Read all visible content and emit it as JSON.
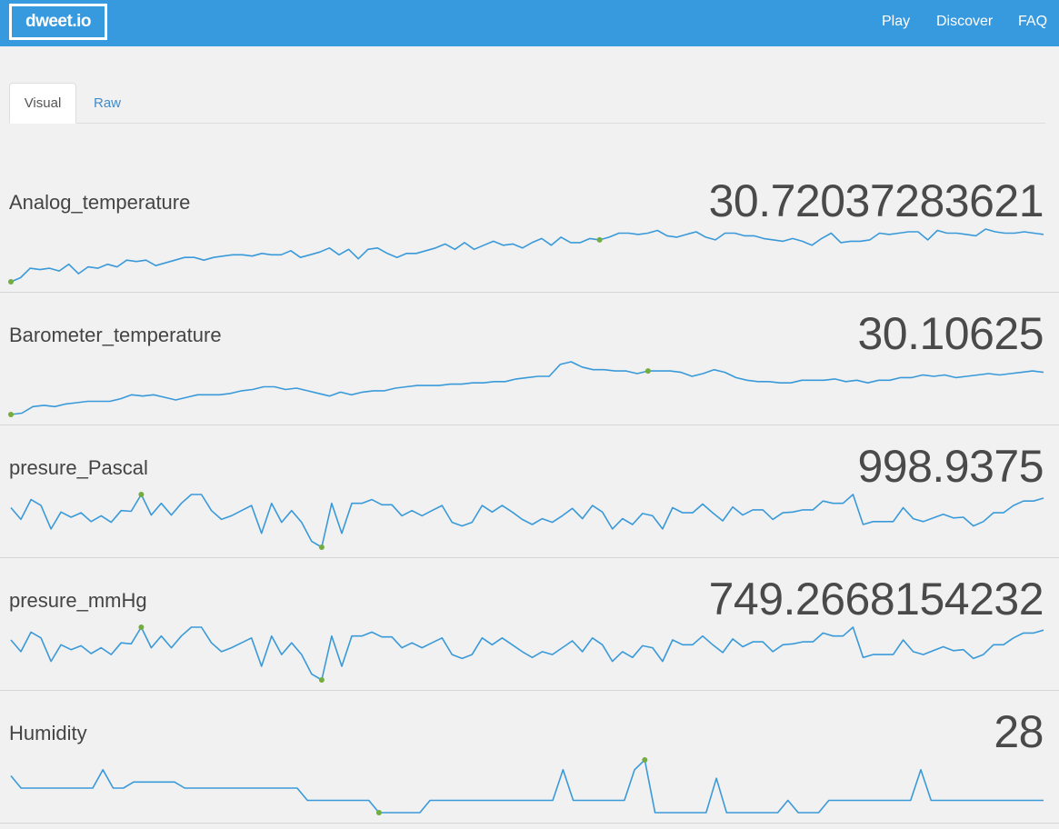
{
  "navbar": {
    "brand": "dweet.io",
    "links": [
      "Play",
      "Discover",
      "FAQ"
    ],
    "background": "#3799de"
  },
  "tabs": {
    "visual": "Visual",
    "raw": "Raw",
    "active": "Visual"
  },
  "colors": {
    "line": "#3a9ad9",
    "marker": "#72ad3d"
  },
  "metrics": [
    {
      "name": "Analog_temperature",
      "value": "30.72037283621",
      "series": [
        22.4,
        22.7,
        23.4,
        23.3,
        23.4,
        23.2,
        23.7,
        23.0,
        23.5,
        23.4,
        23.7,
        23.5,
        24.0,
        23.9,
        24.0,
        23.6,
        23.8,
        24.0,
        24.2,
        24.2,
        24.0,
        24.2,
        24.3,
        24.4,
        24.4,
        24.3,
        24.5,
        24.4,
        24.4,
        24.7,
        24.2,
        24.4,
        24.6,
        24.9,
        24.4,
        24.8,
        24.1,
        24.8,
        24.9,
        24.5,
        24.2,
        24.5,
        24.5,
        24.7,
        24.9,
        25.2,
        24.8,
        25.3,
        24.8,
        25.1,
        25.4,
        25.1,
        25.2,
        24.9,
        25.3,
        25.6,
        25.1,
        25.7,
        25.3,
        25.3,
        25.6,
        25.5,
        25.7,
        26.0,
        26.0,
        25.9,
        26.0,
        26.2,
        25.8,
        25.7,
        25.9,
        26.1,
        25.7,
        25.5,
        26.0,
        26.0,
        25.8,
        25.8,
        25.6,
        25.5,
        25.4,
        25.6,
        25.4,
        25.1,
        25.6,
        26.0,
        25.3,
        25.4,
        25.4,
        25.5,
        26.0,
        25.9,
        26.0,
        26.1,
        26.1,
        25.5,
        26.2,
        26.0,
        26.0,
        25.9,
        25.8,
        26.3,
        26.1,
        26.0,
        26.0,
        26.1,
        26.0,
        25.9
      ],
      "low_index": 0,
      "high_index": 61
    },
    {
      "name": "Barometer_temperature",
      "value": "30.10625",
      "series": [
        22.0,
        22.1,
        22.6,
        22.7,
        22.6,
        22.8,
        22.9,
        23.0,
        23.0,
        23.0,
        23.2,
        23.5,
        23.4,
        23.5,
        23.3,
        23.1,
        23.3,
        23.5,
        23.5,
        23.5,
        23.6,
        23.8,
        23.9,
        24.1,
        24.1,
        23.9,
        24.0,
        23.8,
        23.6,
        23.4,
        23.7,
        23.5,
        23.7,
        23.8,
        23.8,
        24.0,
        24.1,
        24.2,
        24.2,
        24.2,
        24.3,
        24.3,
        24.4,
        24.4,
        24.5,
        24.5,
        24.7,
        24.8,
        24.9,
        24.9,
        25.8,
        26.0,
        25.6,
        25.4,
        25.4,
        25.3,
        25.3,
        25.1,
        25.3,
        25.3,
        25.3,
        25.2,
        24.9,
        25.1,
        25.4,
        25.2,
        24.8,
        24.6,
        24.5,
        24.5,
        24.4,
        24.4,
        24.6,
        24.6,
        24.6,
        24.7,
        24.5,
        24.6,
        24.4,
        24.6,
        24.6,
        24.8,
        24.8,
        25.0,
        24.9,
        25.0,
        24.8,
        24.9,
        25.0,
        25.1,
        25.0,
        25.1,
        25.2,
        25.3,
        25.2
      ],
      "low_index": 0,
      "high_index": 58
    },
    {
      "name": "presure_Pascal",
      "value": "998.9375",
      "series": [
        998.5,
        996.9,
        999.6,
        998.8,
        995.6,
        997.9,
        997.2,
        997.8,
        996.6,
        997.4,
        996.5,
        998.1,
        998.0,
        1000.3,
        997.5,
        999.1,
        997.5,
        999.1,
        1000.3,
        1000.3,
        998.1,
        996.9,
        997.4,
        998.1,
        998.8,
        995.0,
        999.1,
        996.5,
        998.1,
        996.5,
        993.9,
        993.1,
        999.1,
        995.0,
        999.1,
        999.1,
        999.6,
        998.9,
        998.9,
        997.4,
        998.1,
        997.4,
        998.1,
        998.8,
        996.5,
        996.0,
        996.5,
        998.8,
        997.9,
        998.8,
        997.9,
        996.9,
        996.2,
        997.0,
        996.5,
        997.4,
        998.4,
        997.0,
        998.8,
        997.9,
        995.6,
        997.0,
        996.2,
        997.7,
        997.4,
        995.6,
        998.5,
        997.8,
        997.8,
        999.0,
        997.8,
        996.7,
        998.6,
        997.5,
        998.2,
        998.2,
        996.9,
        997.8,
        997.9,
        998.2,
        998.2,
        999.4,
        999.1,
        999.1,
        1000.3,
        996.2,
        996.6,
        996.6,
        996.6,
        998.5,
        997.0,
        996.6,
        997.1,
        997.6,
        997.1,
        997.2,
        996.0,
        996.6,
        997.8,
        997.8,
        998.8,
        999.4,
        999.4,
        999.8
      ]
    },
    {
      "name": "presure_mmHg",
      "value": "749.2668154232",
      "series": [
        748.8,
        747.6,
        749.6,
        749.0,
        746.6,
        748.3,
        747.8,
        748.2,
        747.4,
        748.0,
        747.3,
        748.5,
        748.4,
        750.1,
        748.0,
        749.2,
        748.0,
        749.2,
        750.1,
        750.1,
        748.5,
        747.6,
        748.0,
        748.5,
        749.0,
        746.1,
        749.2,
        747.3,
        748.5,
        747.3,
        745.3,
        744.7,
        749.2,
        746.1,
        749.2,
        749.2,
        749.6,
        749.1,
        749.1,
        748.0,
        748.5,
        748.0,
        748.5,
        749.0,
        747.3,
        746.9,
        747.3,
        749.0,
        748.3,
        749.0,
        748.3,
        747.6,
        747.0,
        747.6,
        747.3,
        748.0,
        748.7,
        747.6,
        749.0,
        748.3,
        746.6,
        747.6,
        747.0,
        748.2,
        748.0,
        746.6,
        748.8,
        748.3,
        748.3,
        749.2,
        748.3,
        747.5,
        748.9,
        748.1,
        748.6,
        748.6,
        747.6,
        748.3,
        748.4,
        748.6,
        748.6,
        749.5,
        749.2,
        749.2,
        750.1,
        747.0,
        747.3,
        747.3,
        747.3,
        748.8,
        747.6,
        747.3,
        747.7,
        748.1,
        747.7,
        747.8,
        746.9,
        747.3,
        748.3,
        748.3,
        749.0,
        749.5,
        749.5,
        749.8
      ]
    },
    {
      "name": "Humidity",
      "value": "28",
      "series": [
        29.0,
        28,
        28,
        28,
        28,
        28,
        28,
        28,
        28,
        29.5,
        28,
        28,
        28.5,
        28.5,
        28.5,
        28.5,
        28.5,
        28,
        28,
        28,
        28,
        28,
        28,
        28,
        28,
        28,
        28,
        28,
        28,
        27,
        27,
        27,
        27,
        27,
        27,
        27,
        26,
        26,
        26,
        26,
        26,
        27,
        27,
        27,
        27,
        27,
        27,
        27,
        27,
        27,
        27,
        27,
        27,
        27,
        29.5,
        27,
        27,
        27,
        27,
        27,
        27,
        29.5,
        30.3,
        26,
        26,
        26,
        26,
        26,
        26,
        28.8,
        26,
        26,
        26,
        26,
        26,
        26,
        27,
        26,
        26,
        26,
        27,
        27,
        27,
        27,
        27,
        27,
        27,
        27,
        27,
        29.5,
        27,
        27,
        27,
        27,
        27,
        27,
        27,
        27,
        27,
        27,
        27,
        27
      ],
      "low_index": 36,
      "high_index": 62
    }
  ]
}
